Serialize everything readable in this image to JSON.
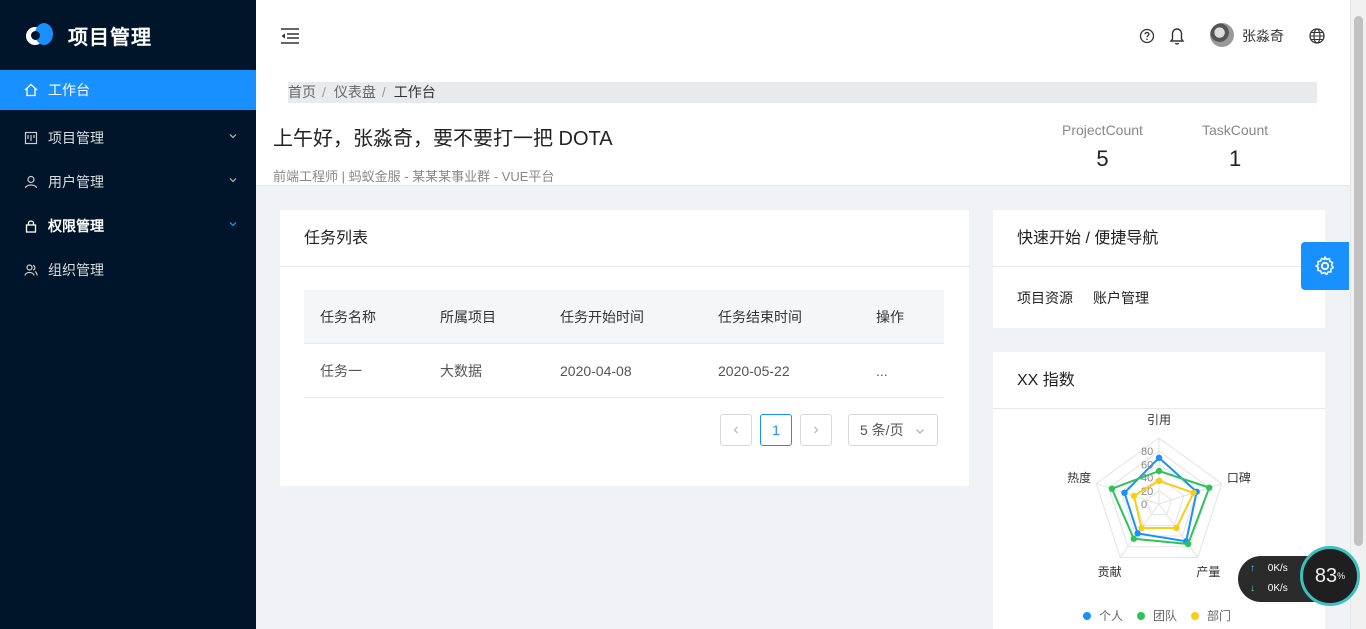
{
  "sidebar": {
    "title": "项目管理",
    "items": [
      {
        "label": "工作台",
        "active": true
      },
      {
        "label": "项目管理"
      },
      {
        "label": "用户管理"
      },
      {
        "label": "权限管理"
      },
      {
        "label": "组织管理"
      }
    ]
  },
  "header": {
    "user_name": "张淼奇"
  },
  "breadcrumb": [
    "首页",
    "仪表盘",
    "工作台"
  ],
  "greeting": {
    "title": "上午好，张淼奇，要不要打一把 DOTA",
    "subtitle": "前端工程师 | 蚂蚁金服 - 某某某事业群 - VUE平台"
  },
  "stats": [
    {
      "label": "ProjectCount",
      "value": "5"
    },
    {
      "label": "TaskCount",
      "value": "1"
    }
  ],
  "tasks": {
    "title": "任务列表",
    "columns": [
      "任务名称",
      "所属项目",
      "任务开始时间",
      "任务结束时间",
      "操作"
    ],
    "rows": [
      [
        "任务一",
        "大数据",
        "2020-04-08",
        "2020-05-22",
        "..."
      ]
    ],
    "pagination": {
      "current": "1",
      "page_size": "5 条/页"
    }
  },
  "quick_nav": {
    "title": "快速开始 / 便捷导航",
    "links": [
      "项目资源",
      "账户管理"
    ]
  },
  "index_chart": {
    "title": "XX 指数"
  },
  "net_widget": {
    "up": "0K/s",
    "down": "0K/s",
    "percent": "83"
  },
  "chart_data": {
    "type": "radar",
    "title": "XX 指数",
    "indicators": [
      "引用",
      "口碑",
      "产量",
      "贡献",
      "热度"
    ],
    "radial_ticks": [
      "0",
      "20",
      "40",
      "60",
      "80"
    ],
    "max": 100,
    "series": [
      {
        "name": "个人",
        "color": "#1890ff",
        "values": [
          70,
          60,
          70,
          55,
          55
        ]
      },
      {
        "name": "团队",
        "color": "#2fc25b",
        "values": [
          50,
          80,
          75,
          65,
          75
        ]
      },
      {
        "name": "部门",
        "color": "#facc14",
        "values": [
          35,
          55,
          45,
          45,
          40
        ]
      }
    ],
    "legend_position": "bottom"
  },
  "colors": {
    "sidebar_bg": "#001529",
    "accent": "#1890ff"
  }
}
